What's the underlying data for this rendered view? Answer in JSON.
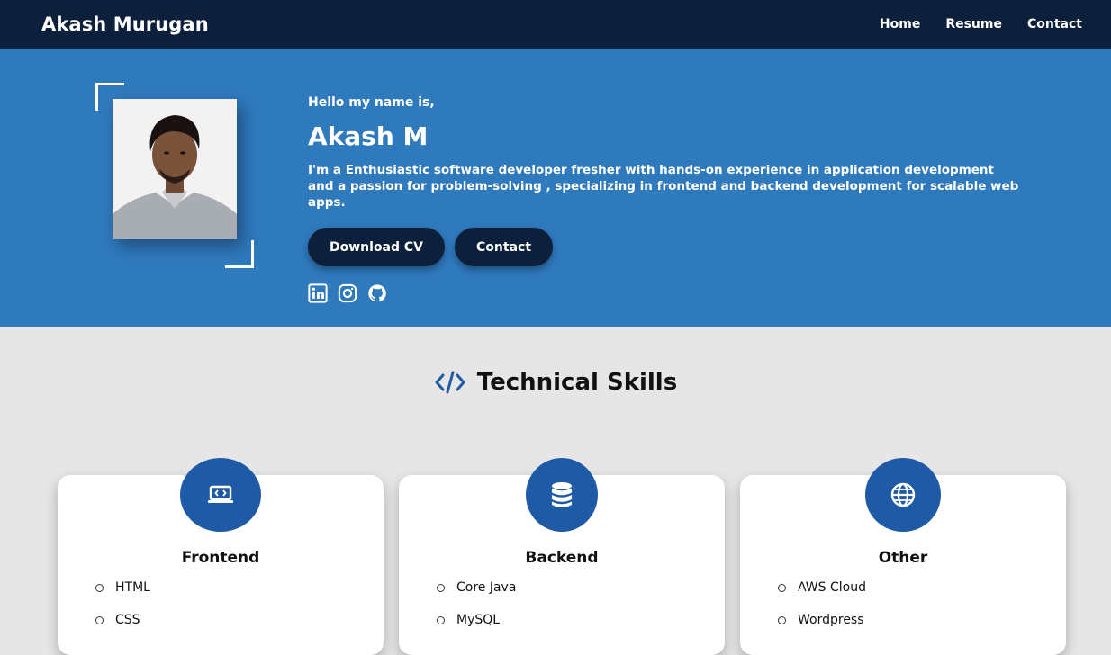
{
  "navbar": {
    "brand": "Akash Murugan",
    "links": [
      {
        "label": "Home"
      },
      {
        "label": "Resume"
      },
      {
        "label": "Contact"
      }
    ]
  },
  "hero": {
    "greeting": "Hello my name is,",
    "name": "Akash M",
    "description": "I'm a Enthusiastic software developer fresher with hands-on experience in application development and a passion for problem-solving , specializing in frontend and backend development for scalable web apps.",
    "buttons": {
      "download_cv": "Download CV",
      "contact": "Contact"
    },
    "socials": [
      "linkedin-icon",
      "instagram-icon",
      "github-icon"
    ]
  },
  "skills": {
    "title": "Technical Skills",
    "cards": [
      {
        "title": "Frontend",
        "icon": "laptop-code-icon",
        "items": [
          "HTML",
          "CSS"
        ]
      },
      {
        "title": "Backend",
        "icon": "database-icon",
        "items": [
          "Core Java",
          "MySQL"
        ]
      },
      {
        "title": "Other",
        "icon": "globe-icon",
        "items": [
          "AWS Cloud",
          "Wordpress"
        ]
      }
    ]
  },
  "colors": {
    "navbar": "#0c1f3b",
    "hero": "#2f79bd",
    "accent": "#1f5aa6",
    "page_background": "#e6e6e6"
  }
}
